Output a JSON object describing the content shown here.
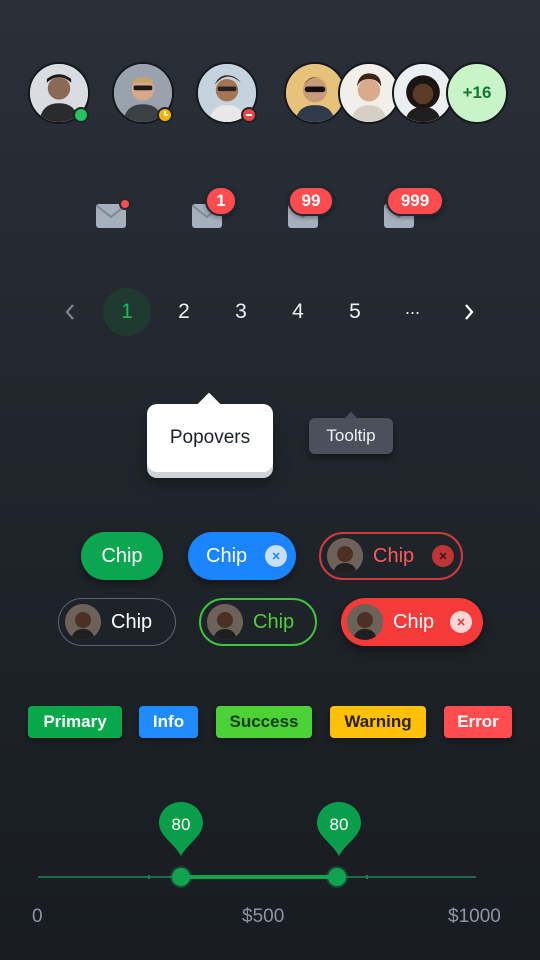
{
  "avatars": {
    "overflow_label": "+16"
  },
  "mail_badges": {
    "counts": [
      "1",
      "99",
      "999"
    ]
  },
  "pagination": {
    "pages": [
      "1",
      "2",
      "3",
      "4",
      "5"
    ],
    "ellipsis": "···",
    "prev_icon": "chevron-left-icon",
    "next_icon": "chevron-right-icon",
    "active_page": "1"
  },
  "popover": {
    "label": "Popovers"
  },
  "tooltip": {
    "label": "Tooltip"
  },
  "chips": {
    "row1": [
      "Chip",
      "Chip",
      "Chip"
    ],
    "row2": [
      "Chip",
      "Chip",
      "Chip"
    ]
  },
  "labels": [
    "Primary",
    "Info",
    "Success",
    "Warning",
    "Error"
  ],
  "slider": {
    "min_label": "0",
    "mid_label": "$500",
    "max_label": "$1000",
    "low_value": "80",
    "high_value": "80"
  },
  "colors": {
    "primary": "#07a84a",
    "info": "#1e8cff",
    "success": "#4cd137",
    "warning": "#ffc107",
    "error": "#ff4d4f",
    "badge_red": "#ff4d4f",
    "online": "#22c55e",
    "away": "#f4b400",
    "busy": "#ef4444"
  }
}
